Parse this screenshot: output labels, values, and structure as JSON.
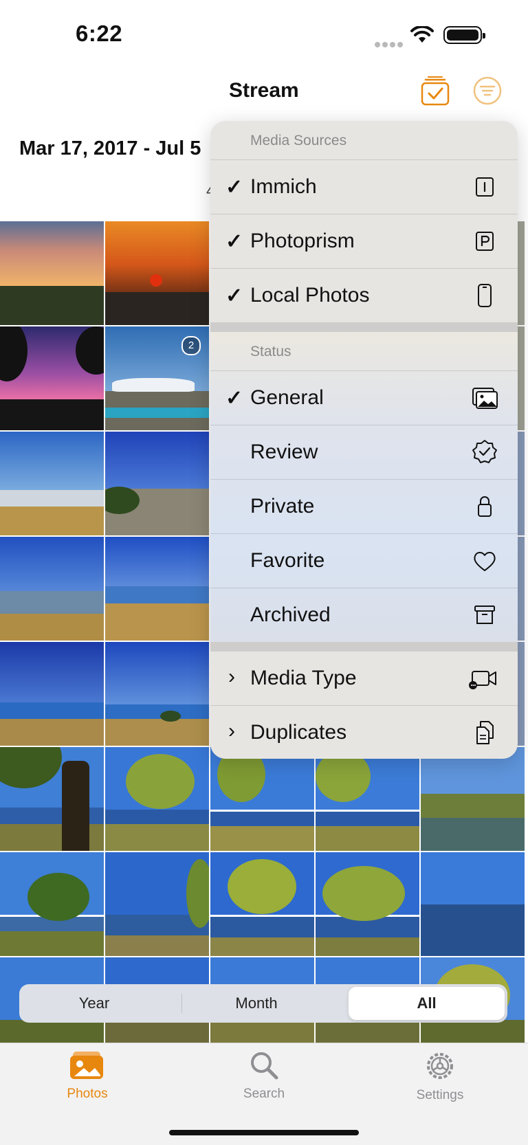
{
  "status_bar": {
    "time": "6:22"
  },
  "header": {
    "title": "Stream",
    "date_range": "Mar 17, 2017 - Jul 5",
    "count_peek": "4"
  },
  "grid": {
    "badge_count": "2"
  },
  "menu": {
    "sources_heading": "Media Sources",
    "sources": [
      {
        "label": "Immich",
        "checked": true,
        "icon": "immich-letter-i-icon"
      },
      {
        "label": "Photoprism",
        "checked": true,
        "icon": "photoprism-letter-p-icon"
      },
      {
        "label": "Local Photos",
        "checked": true,
        "icon": "phone-icon"
      }
    ],
    "status_heading": "Status",
    "status": [
      {
        "label": "General",
        "checked": true,
        "icon": "photos-icon"
      },
      {
        "label": "Review",
        "checked": false,
        "icon": "verified-badge-icon"
      },
      {
        "label": "Private",
        "checked": false,
        "icon": "lock-icon"
      },
      {
        "label": "Favorite",
        "checked": false,
        "icon": "heart-icon"
      },
      {
        "label": "Archived",
        "checked": false,
        "icon": "archive-box-icon"
      }
    ],
    "submenus": [
      {
        "label": "Media Type",
        "icon": "video-camera-icon"
      },
      {
        "label": "Duplicates",
        "icon": "documents-copy-icon"
      }
    ]
  },
  "segmented": {
    "options": [
      "Year",
      "Month",
      "All"
    ],
    "selected": "All"
  },
  "tabbar": {
    "tabs": [
      {
        "label": "Photos",
        "icon": "photos-icon",
        "active": true
      },
      {
        "label": "Search",
        "icon": "magnifier-icon",
        "active": false
      },
      {
        "label": "Settings",
        "icon": "gear-icon",
        "active": false
      }
    ]
  },
  "colors": {
    "accent": "#e8870e",
    "menu_bg": "#e6e5e2",
    "tab_inactive": "#8e8e93"
  }
}
